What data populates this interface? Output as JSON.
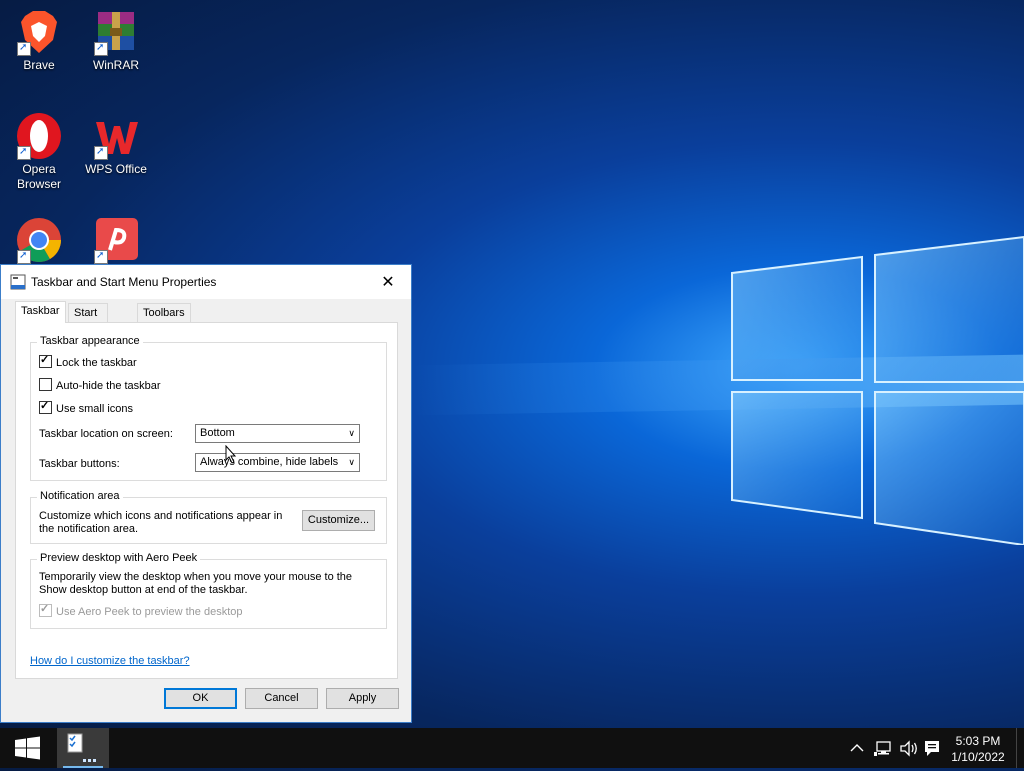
{
  "desktop": {
    "icons": [
      {
        "label": "Brave",
        "icon": "brave-icon"
      },
      {
        "label": "WinRAR",
        "icon": "winrar-icon"
      },
      {
        "label": "Opera Browser",
        "icon": "opera-icon"
      },
      {
        "label": "WPS Office",
        "icon": "wps-office-icon"
      },
      {
        "label": "",
        "icon": "chrome-icon"
      },
      {
        "label": "",
        "icon": "wps-pdf-icon"
      }
    ]
  },
  "dialog": {
    "title": "Taskbar and Start Menu Properties",
    "close_symbol": "✕",
    "tabs": [
      "Taskbar",
      "Start Menu",
      "Toolbars"
    ],
    "active_tab": "Taskbar",
    "appearance": {
      "title": "Taskbar appearance",
      "lock_label": "Lock the taskbar",
      "lock_checked": true,
      "autohide_label": "Auto-hide the taskbar",
      "autohide_checked": false,
      "small_icons_label": "Use small icons",
      "small_icons_checked": true,
      "location_label": "Taskbar location on screen:",
      "location_value": "Bottom",
      "buttons_label": "Taskbar buttons:",
      "buttons_value": "Always combine, hide labels"
    },
    "notification": {
      "title": "Notification area",
      "text": "Customize which icons and notifications appear in the notification area.",
      "button": "Customize..."
    },
    "aero_peek": {
      "title": "Preview desktop with Aero Peek",
      "text": "Temporarily view the desktop when you move your mouse to the Show desktop button at end of the taskbar.",
      "checkbox_label": "Use Aero Peek to preview the desktop",
      "checked": true,
      "disabled": true
    },
    "help_link": "How do I customize the taskbar?",
    "buttons": {
      "ok": "OK",
      "cancel": "Cancel",
      "apply": "Apply"
    }
  },
  "taskbar": {
    "time": "5:03 PM",
    "date": "1/10/2022",
    "tray_icons": [
      "chevron-up-icon",
      "network-icon",
      "volume-icon",
      "notifications-icon"
    ]
  },
  "colors": {
    "accent": "#0078d7",
    "link": "#0066cc",
    "taskbar": "#101010"
  }
}
